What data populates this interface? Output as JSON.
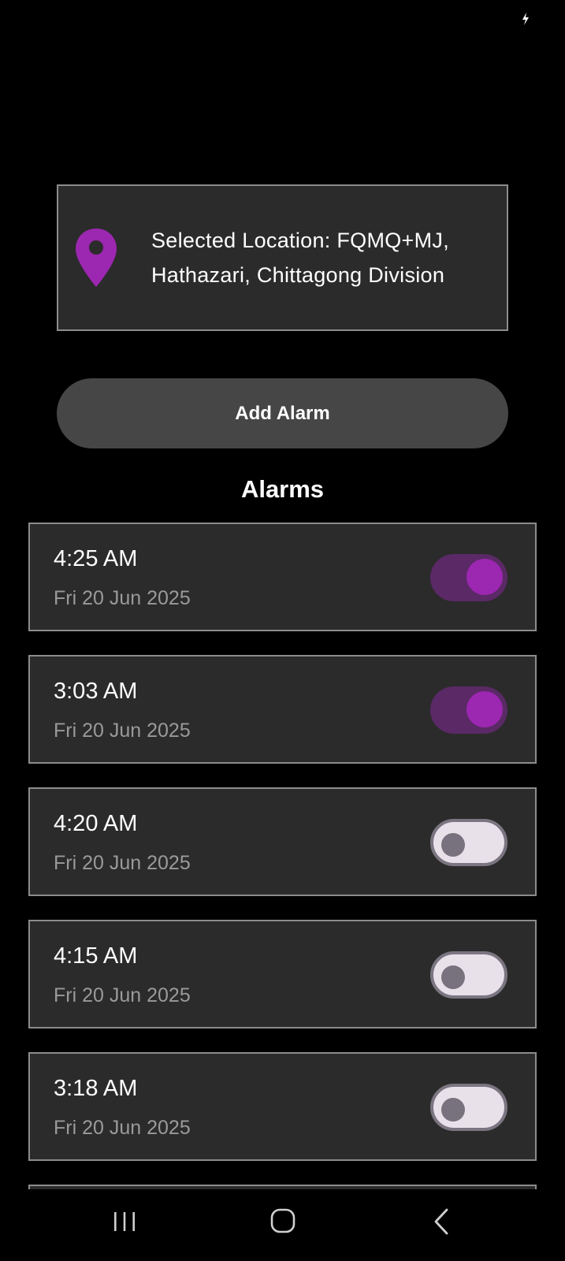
{
  "location": {
    "text": "Selected Location: FQMQ+MJ, Hathazari, Chittagong Division",
    "icon": "location-pin-icon"
  },
  "add_alarm_label": "Add Alarm",
  "alarms_heading": "Alarms",
  "alarms": [
    {
      "time": "4:25 AM",
      "date": "Fri 20 Jun 2025",
      "enabled": true
    },
    {
      "time": "3:03 AM",
      "date": "Fri 20 Jun 2025",
      "enabled": true
    },
    {
      "time": "4:20 AM",
      "date": "Fri 20 Jun 2025",
      "enabled": false
    },
    {
      "time": "4:15 AM",
      "date": "Fri 20 Jun 2025",
      "enabled": false
    },
    {
      "time": "3:18 AM",
      "date": "Fri 20 Jun 2025",
      "enabled": false
    }
  ],
  "colors": {
    "background": "#000000",
    "card": "#2b2b2b",
    "accent": "#9c27b0",
    "button": "#464646"
  }
}
